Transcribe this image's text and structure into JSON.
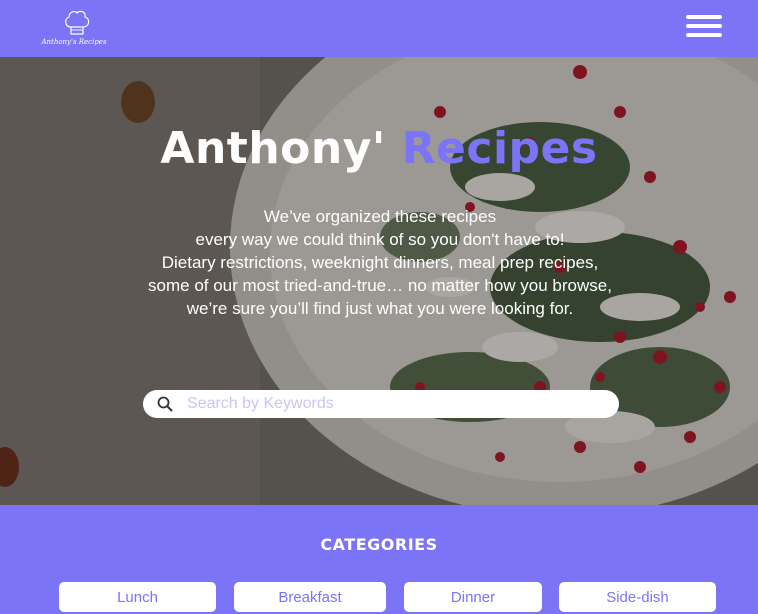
{
  "header": {
    "logo_text": "Anthony's Recipes",
    "menu_icon": "hamburger-menu-icon"
  },
  "hero": {
    "title_main": "Anthony' ",
    "title_accent": "Recipes",
    "description": [
      "We’ve organized these recipes",
      "every way we could think of so you don't have to!",
      "Dietary restrictions, weeknight dinners, meal prep recipes,",
      "some of our most tried-and-true… no matter how you browse,",
      "we’re sure you’ll find just what you were looking for."
    ]
  },
  "search": {
    "placeholder": "Search by Keywords",
    "value": "",
    "icon": "search-icon"
  },
  "categories": {
    "title": "CATEGORIES",
    "items": [
      "Lunch",
      "Breakfast",
      "Dinner",
      "Side-dish"
    ]
  },
  "colors": {
    "brand": "#7b74f6",
    "white": "#ffffff"
  }
}
